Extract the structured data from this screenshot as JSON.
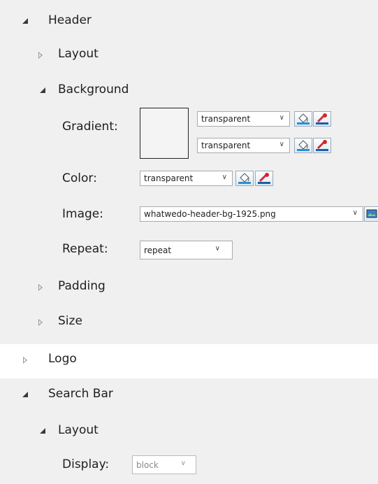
{
  "header": {
    "label": "Header"
  },
  "layout1": {
    "label": "Layout"
  },
  "background": {
    "label": "Background",
    "gradient_label": "Gradient:",
    "gradient_stop1": "transparent",
    "gradient_stop2": "transparent",
    "color_label": "Color:",
    "color_value": "transparent",
    "image_label": "Image:",
    "image_value": "whatwedo-header-bg-1925.png",
    "repeat_label": "Repeat:",
    "repeat_value": "repeat"
  },
  "padding": {
    "label": "Padding"
  },
  "size": {
    "label": "Size"
  },
  "logo": {
    "label": "Logo"
  },
  "searchbar": {
    "label": "Search Bar"
  },
  "layout2": {
    "label": "Layout",
    "display_label": "Display:",
    "display_value": "block"
  },
  "icons": {
    "expanded": "expanded-triangle-icon",
    "collapsed": "collapsed-triangle-icon",
    "fill": "paint-bucket-icon",
    "picker": "eyedropper-icon",
    "image": "image-icon",
    "dropdown": "chevron-down-icon"
  }
}
